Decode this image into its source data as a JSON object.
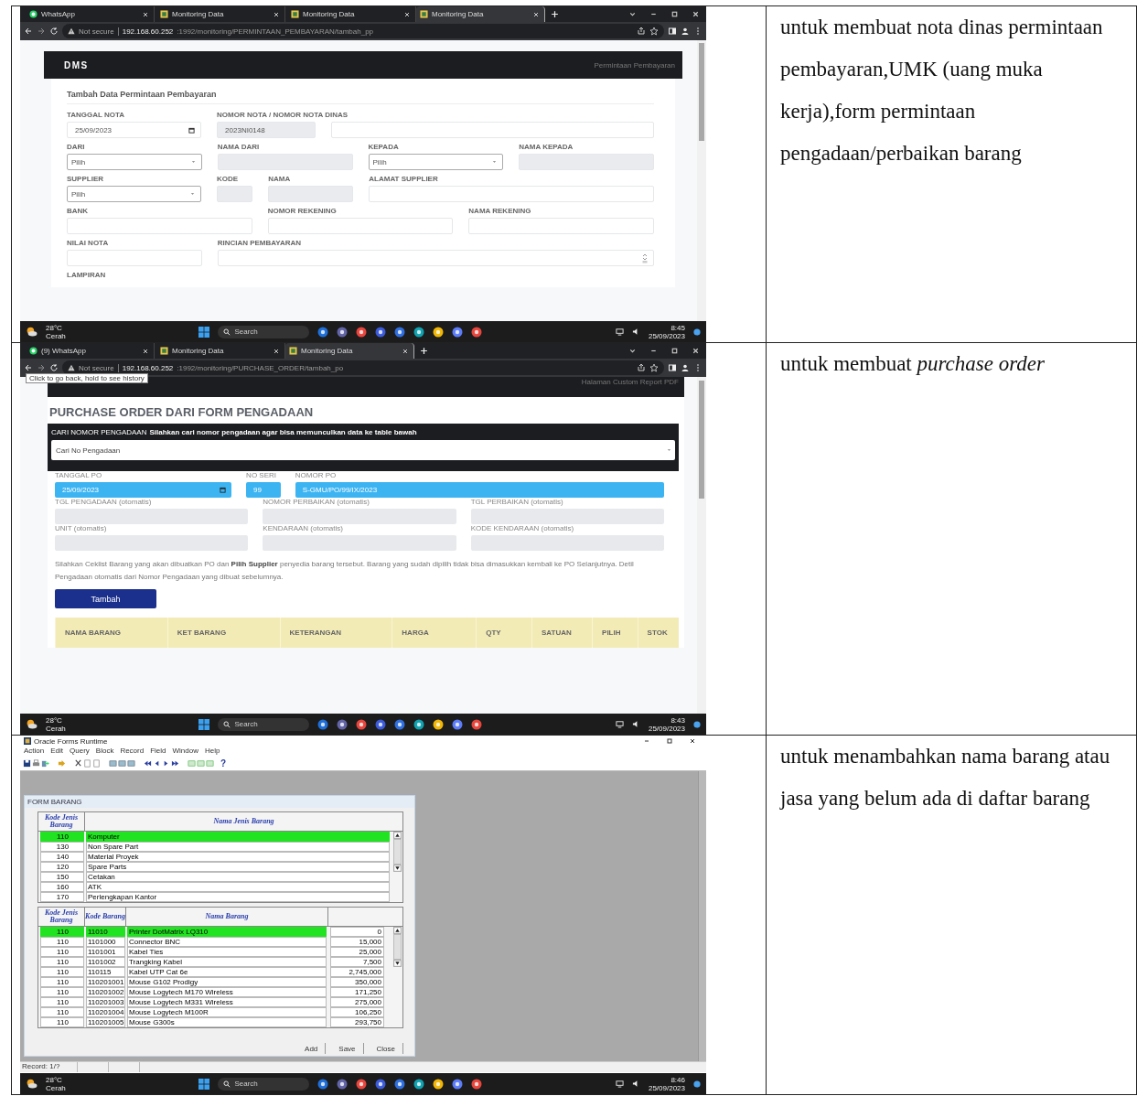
{
  "rows": [
    {
      "shot": {
        "kind": "dms_payment",
        "browser": {
          "tabs": [
            {
              "kind": "whatsapp",
              "title": "WhatsApp",
              "selected": false
            },
            {
              "kind": "monitoring",
              "title": "Monitoring Data",
              "selected": false
            },
            {
              "kind": "monitoring",
              "title": "Monitoring Data",
              "selected": false
            },
            {
              "kind": "monitoring",
              "title": "Monitoring Data",
              "selected": true
            }
          ],
          "security": "Not secure",
          "host": "192.168.60.252",
          "path": ":1992/monitoring/PERMINTAAN_PEMBAYARAN/tambah_pp"
        },
        "brand": "DMS",
        "breadcrumb": "Permintaan Pembayaran",
        "card_title": "Tambah Data Permintaan Pembayaran",
        "field_rows": [
          [
            {
              "label": "TANGGAL NOTA",
              "kind": "date",
              "value": "25/09/2023"
            },
            {
              "label": "NOMOR NOTA / NOMOR NOTA DINAS",
              "kind": "readonly",
              "value": "2023NI0148"
            },
            {
              "kind": "text"
            }
          ],
          [
            {
              "label": "DARI",
              "kind": "select",
              "value": "Pilih"
            },
            {
              "label": "NAMA DARI",
              "kind": "readonly"
            },
            {
              "label": "KEPADA",
              "kind": "select",
              "value": "Pilih"
            },
            {
              "label": "NAMA KEPADA",
              "kind": "readonly"
            }
          ],
          [
            {
              "label": "SUPPLIER",
              "kind": "select",
              "value": "Pilih"
            },
            {
              "label": "KODE",
              "kind": "readonly"
            },
            {
              "label": "NAMA",
              "kind": "readonly"
            },
            {
              "label": "ALAMAT SUPPLIER",
              "kind": "text"
            }
          ],
          [
            {
              "label": "BANK",
              "kind": "text"
            },
            {
              "label": "NOMOR REKENING",
              "kind": "text"
            },
            {
              "label": "NAMA REKENING",
              "kind": "text"
            }
          ],
          [
            {
              "label": "NILAI NOTA",
              "kind": "text"
            },
            {
              "label": "RINCIAN PEMBAYARAN",
              "kind": "textarea"
            }
          ],
          [
            {
              "label": "LAMPIRAN",
              "kind": "none"
            }
          ]
        ],
        "taskbar": {
          "temp": "28°C",
          "weather": "Cerah",
          "search": "Search",
          "time": "8:45",
          "date": "25/09/2023"
        }
      },
      "description": "untuk membuat nota dinas permintaan pembayaran,UMK (uang muka kerja),form permintaan pengadaan/perbaikan barang"
    },
    {
      "shot": {
        "kind": "purchase_order",
        "browser": {
          "tabs": [
            {
              "kind": "whatsapp",
              "title": "(9) WhatsApp",
              "selected": false
            },
            {
              "kind": "monitoring",
              "title": "Monitoring Data",
              "selected": false
            },
            {
              "kind": "monitoring",
              "title": "Monitoring Data",
              "selected": true
            }
          ],
          "security": "Not secure",
          "host": "192.168.60.252",
          "path": ":1992/monitoring/PURCHASE_ORDER/tambah_po",
          "tooltip": "Click to go back, hold to see history"
        },
        "header_link": "Halaman Custom Report PDF",
        "title": "PURCHASE ORDER DARI FORM PENGADAAN",
        "search_panel": {
          "title": "CARI NOMOR PENGADAAN",
          "hint": "Silahkan cari nomor pengadaan agar bisa memunculkan data ke table bawah",
          "placeholder": "Cari No Pengadaan"
        },
        "field_rows": [
          [
            {
              "label": "TANGGAL PO",
              "kind": "date",
              "value": "25/09/2023",
              "highlighted": true
            },
            {
              "label": "NO SERI",
              "kind": "text",
              "value": "99",
              "highlighted": true
            },
            {
              "label": "NOMOR PO",
              "kind": "text",
              "value": "S-GMU/PO/99/IX/2023",
              "highlighted": true
            }
          ],
          [
            {
              "label": "TGL PENGADAAN (otomatis)",
              "kind": "readonly"
            },
            {
              "label": "NOMOR PERBAIKAN (otomatis)",
              "kind": "readonly"
            },
            {
              "label": "TGL PERBAIKAN (otomatis)",
              "kind": "readonly"
            }
          ],
          [
            {
              "label": "UNIT (otomatis)",
              "kind": "readonly"
            },
            {
              "label": "KENDARAAN (otomatis)",
              "kind": "readonly"
            },
            {
              "label": "KODE KENDARAAN (otomatis)",
              "kind": "readonly"
            }
          ]
        ],
        "note": "Silahkan Ceklist Barang yang akan dibuatkan PO dan **Pilih Supplier** penyedia barang tersebut. Barang yang sudah dipilih tidak bisa dimasukkan kembali ke PO Selanjutnya. Detil Pengadaan otomatis dari Nomor Pengadaan yang dibuat sebelumnya.",
        "button": "Tambah",
        "columns": [
          "NAMA BARANG",
          "KET BARANG",
          "KETERANGAN",
          "HARGA",
          "QTY",
          "SATUAN",
          "PILIH",
          "STOK"
        ],
        "taskbar": {
          "temp": "28°C",
          "weather": "Cerah",
          "search": "Search",
          "time": "8:43",
          "date": "25/09/2023"
        }
      },
      "description": "untuk membuat *purchase order*"
    },
    {
      "shot": {
        "kind": "oracle_forms",
        "app_title": "Oracle Forms Runtime",
        "menu": [
          "Action",
          "Edit",
          "Query",
          "Block",
          "Record",
          "Field",
          "Window",
          "Help"
        ],
        "help_glyph": "?",
        "form_title": "FORM BARANG",
        "type_columns": [
          "Kode Jenis Barang",
          "Nama Jenis Barang"
        ],
        "types": [
          {
            "code": "110",
            "name": "Komputer",
            "selected": true
          },
          {
            "code": "130",
            "name": "Non Spare Part",
            "selected": false
          },
          {
            "code": "140",
            "name": "Material Proyek",
            "selected": false
          },
          {
            "code": "120",
            "name": "Spare Parts",
            "selected": false
          },
          {
            "code": "150",
            "name": "Cetakan",
            "selected": false
          },
          {
            "code": "160",
            "name": "ATK",
            "selected": false
          },
          {
            "code": "170",
            "name": "Perlengkapan Kantor",
            "selected": false
          }
        ],
        "item_columns": [
          "Kode Jenis Barang",
          "Kode Barang",
          "Nama Barang"
        ],
        "items": [
          {
            "type_code": "110",
            "code": "11010",
            "name": "Printer DotMatrix LQ310",
            "price": "0",
            "selected": true
          },
          {
            "type_code": "110",
            "code": "1101000",
            "name": "Connector BNC",
            "price": "15,000",
            "selected": false
          },
          {
            "type_code": "110",
            "code": "1101001",
            "name": "Kabel Ties",
            "price": "25,000",
            "selected": false
          },
          {
            "type_code": "110",
            "code": "1101002",
            "name": "Trangking Kabel",
            "price": "7,500",
            "selected": false
          },
          {
            "type_code": "110",
            "code": "110115",
            "name": "Kabel UTP Cat 6e",
            "price": "2,745,000",
            "selected": false
          },
          {
            "type_code": "110",
            "code": "110201001",
            "name": "Mouse G102 Prodigy",
            "price": "350,000",
            "selected": false
          },
          {
            "type_code": "110",
            "code": "110201002",
            "name": "Mouse Logytech M170 Wireless",
            "price": "171,250",
            "selected": false
          },
          {
            "type_code": "110",
            "code": "110201003",
            "name": "Mouse Logytech M331 Wireless",
            "price": "275,000",
            "selected": false
          },
          {
            "type_code": "110",
            "code": "110201004",
            "name": "Mouse Logytech M100R",
            "price": "106,250",
            "selected": false
          },
          {
            "type_code": "110",
            "code": "110201005",
            "name": "Mouse G300s",
            "price": "293,750",
            "selected": false
          }
        ],
        "buttons": [
          "Add",
          "Save",
          "Close"
        ],
        "status": "Record: 1/?",
        "taskbar": {
          "temp": "28°C",
          "weather": "Cerah",
          "search": "Search",
          "time": "8:46",
          "date": "25/09/2023"
        }
      },
      "description": "untuk menambahkan nama barang atau jasa yang belum ada di daftar barang"
    }
  ]
}
